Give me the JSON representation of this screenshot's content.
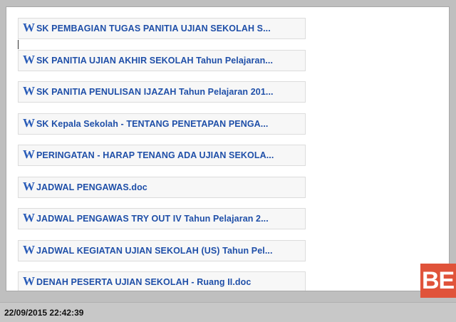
{
  "files": [
    {
      "icon": "W",
      "label": "SK PEMBAGIAN TUGAS PANITIA UJIAN SEKOLAH S..."
    },
    {
      "icon": "W",
      "label": "SK PANITIA UJIAN AKHIR SEKOLAH Tahun Pelajaran..."
    },
    {
      "icon": "W",
      "label": "SK PANITIA PENULISAN IJAZAH Tahun Pelajaran 201..."
    },
    {
      "icon": "W",
      "label": "SK Kepala Sekolah - TENTANG PENETAPAN PENGA..."
    },
    {
      "icon": "W",
      "label": "PERINGATAN - HARAP TENANG ADA UJIAN SEKOLA..."
    },
    {
      "icon": "W",
      "label": "JADWAL PENGAWAS.doc"
    },
    {
      "icon": "W",
      "label": "JADWAL PENGAWAS TRY OUT IV Tahun Pelajaran 2..."
    },
    {
      "icon": "W",
      "label": "JADWAL KEGIATAN UJIAN SEKOLAH (US) Tahun Pel..."
    },
    {
      "icon": "W",
      "label": "DENAH PESERTA UJIAN SEKOLAH - Ruang II.doc"
    }
  ],
  "logo": {
    "text": "BE",
    "color": "#e0533a"
  },
  "status": {
    "timestamp": "22/09/2015 22:42:39"
  },
  "colors": {
    "link": "#1f4fa8",
    "icon": "#2a5cb8"
  }
}
